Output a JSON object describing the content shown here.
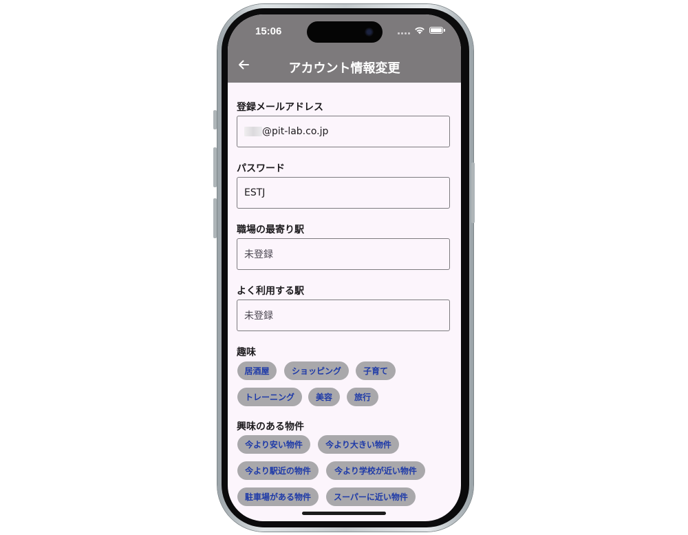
{
  "status_bar": {
    "time": "15:06"
  },
  "header": {
    "title": "アカウント情報変更"
  },
  "form": {
    "email": {
      "label": "登録メールアドレス",
      "value": "@pit-lab.co.jp"
    },
    "password": {
      "label": "パスワード",
      "value": "ESTJ"
    },
    "work_station": {
      "label": "職場の最寄り駅",
      "value": "未登録"
    },
    "frequent_station": {
      "label": "よく利用する駅",
      "value": "未登録"
    }
  },
  "hobbies": {
    "label": "趣味",
    "items": [
      "居酒屋",
      "ショッピング",
      "子育て",
      "トレーニング",
      "美容",
      "旅行"
    ]
  },
  "interests": {
    "label": "興味のある物件",
    "items": [
      "今より安い物件",
      "今より大きい物件",
      "今より駅近の物件",
      "今より学校が近い物件",
      "駐車場がある物件",
      "スーパーに近い物件"
    ]
  },
  "colors": {
    "header_bg": "#7d7a7c",
    "screen_bg": "#fcf5fc",
    "chip_bg": "#a9a8ab",
    "chip_text": "#1e3aa8"
  },
  "icons": {
    "back": "arrow-left-icon",
    "signal": "signal-icon",
    "wifi": "wifi-icon",
    "battery": "battery-icon"
  }
}
